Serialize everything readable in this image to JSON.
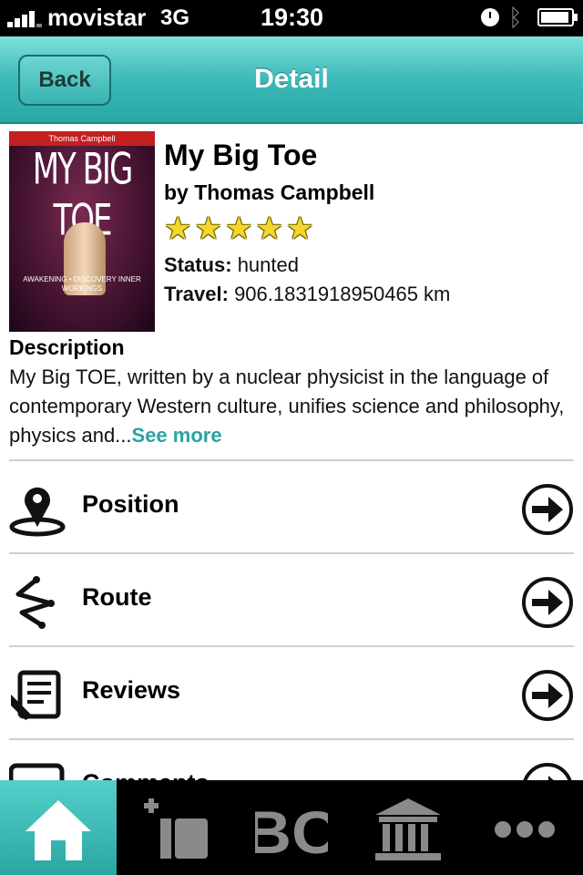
{
  "status_bar": {
    "carrier": "movistar",
    "network": "3G",
    "time": "19:30"
  },
  "nav": {
    "back_label": "Back",
    "title": "Detail"
  },
  "book": {
    "cover_author": "Thomas Campbell",
    "cover_title": "MY BIG TOE",
    "cover_subtitle": "AWAKENING • DISCOVERY INNER WORKINGS",
    "title": "My Big Toe",
    "author": "by Thomas Campbell",
    "rating": 5,
    "rating_max": 5,
    "status_label": "Status:",
    "status_value": "hunted",
    "travel_label": "Travel:",
    "travel_value": "906.1831918950465 km"
  },
  "description": {
    "heading": "Description",
    "text": "My Big TOE, written by a nuclear physicist in the language of contemporary Western culture, unifies science and philosophy, physics and...",
    "see_more": "See more"
  },
  "menu": [
    {
      "label": "Position",
      "icon": "map-pin-icon"
    },
    {
      "label": "Route",
      "icon": "route-icon"
    },
    {
      "label": "Reviews",
      "icon": "reviews-icon"
    },
    {
      "label": "Comments",
      "icon": "comments-icon"
    }
  ],
  "tabs": [
    {
      "icon": "home-icon",
      "active": true
    },
    {
      "icon": "add-book-icon",
      "active": false
    },
    {
      "icon": "bc-icon",
      "active": false
    },
    {
      "icon": "institution-icon",
      "active": false
    },
    {
      "icon": "more-icon",
      "active": false
    }
  ],
  "tab_bc_text": "BC",
  "colors": {
    "accent": "#2aa3a0",
    "nav_gradient_top": "#7fe0db",
    "nav_gradient_bottom": "#28a7a6",
    "star": "#f4d72a"
  }
}
